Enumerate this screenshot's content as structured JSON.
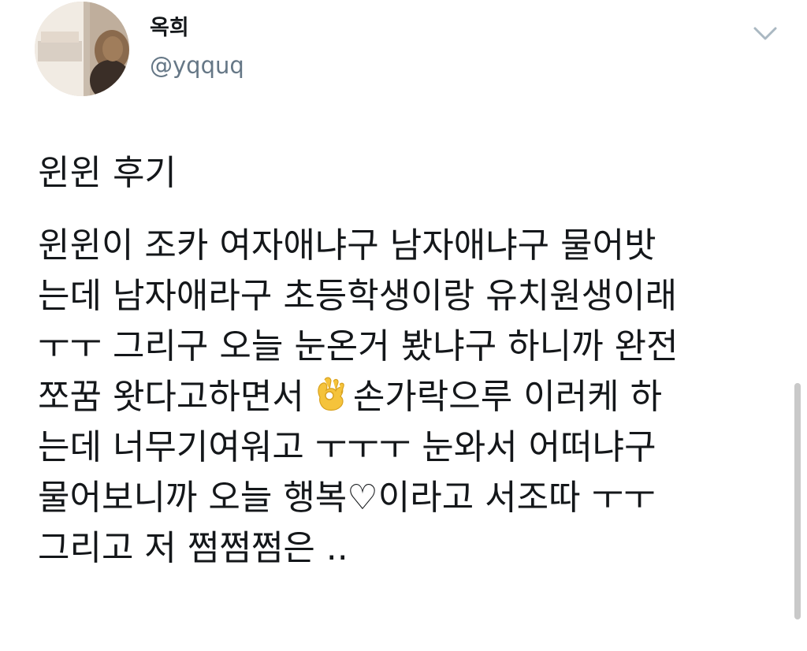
{
  "author": {
    "display_name": "옥희",
    "handle": "@yqquq"
  },
  "tweet": {
    "lines": [
      "윈윈 후기",
      "윈윈이 조카 여자애냐구 남자애냐구 물어밧",
      "는데 남자애라구 초등학생이랑 유치원생이래",
      "ㅜㅜ 그리구 오늘 눈온거 봤냐구 하니까 완전",
      "쪼꿈 왓다고하면서",
      "손가락으루 이러케 하",
      "는데 너무기여워고 ㅜㅜㅜ 눈와서 어떠냐구",
      "물어보니까 오늘 행복♡이라고 서조따 ㅜㅜ",
      "그리고 저 쩜쩜쩜은 .."
    ]
  },
  "icons": {
    "emoji": "ok-hand-emoji",
    "menu": "chevron-down-icon"
  },
  "colors": {
    "text": "#14171a",
    "secondary": "#657786",
    "background": "#ffffff"
  }
}
